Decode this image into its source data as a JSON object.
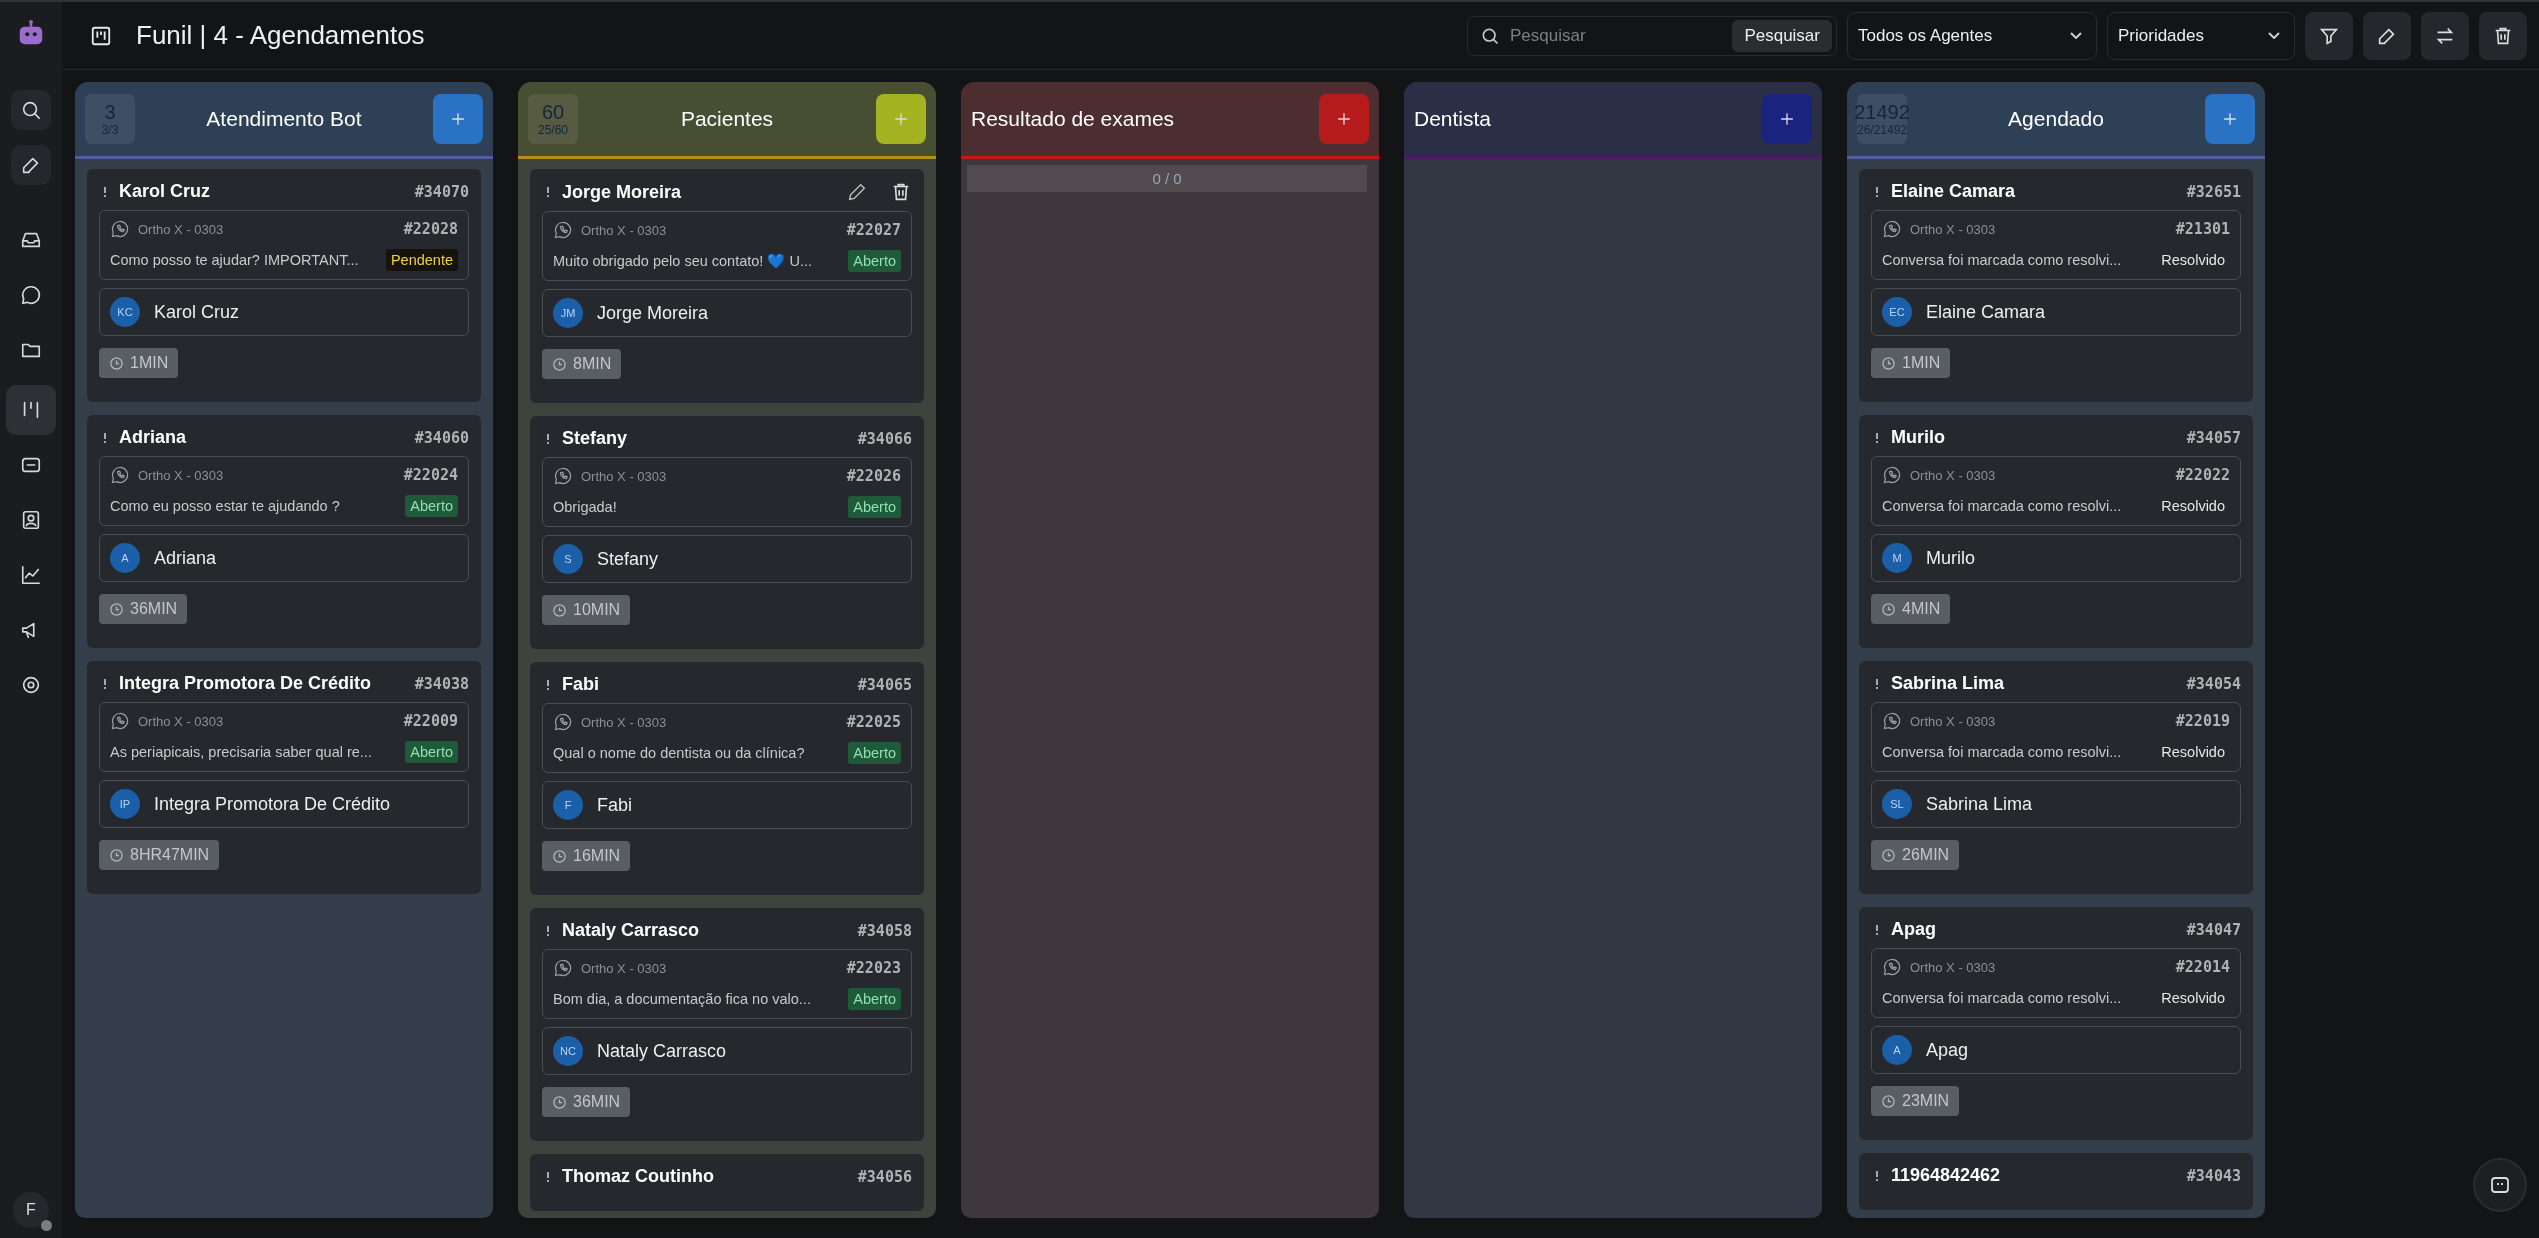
{
  "sidebar": {
    "nav": [
      {
        "selected": false
      },
      {
        "selected": false
      },
      {
        "selected": false
      },
      {
        "selected": false
      },
      {
        "selected": false
      },
      {
        "selected": true
      },
      {
        "selected": false
      },
      {
        "selected": false
      },
      {
        "selected": false
      },
      {
        "selected": false
      },
      {
        "selected": false
      }
    ],
    "user": {
      "initial": "F"
    }
  },
  "header": {
    "title": "Funil | 4 - Agendamentos",
    "search": {
      "placeholder": "Pesquisar",
      "button": "Pesquisar"
    },
    "agent_filter": "Todos os Agentes",
    "priority_filter": "Prioridades"
  },
  "columns": [
    {
      "title": "Atendimento Bot",
      "color": "#2a73c4",
      "count": "3",
      "fraction": "3/3",
      "cards": [
        {
          "name": "Karol Cruz",
          "id": "#34070",
          "show_actions": false,
          "inbox": "Ortho X - 0303",
          "conversation_id": "#22028",
          "message": "Como posso te ajudar? IMPORTANT...",
          "status": {
            "text": "Pendente",
            "kind": "pending"
          },
          "initials": "KC",
          "contact": "Karol Cruz",
          "time": "1MIN"
        },
        {
          "name": "Adriana",
          "id": "#34060",
          "show_actions": false,
          "inbox": "Ortho X - 0303",
          "conversation_id": "#22024",
          "message": "Como eu posso estar te ajudando ?",
          "status": {
            "text": "Aberto",
            "kind": "open"
          },
          "initials": "A",
          "contact": "Adriana",
          "time": "36MIN"
        },
        {
          "name": "Integra Promotora De Crédito",
          "id": "#34038",
          "show_actions": false,
          "inbox": "Ortho X - 0303",
          "conversation_id": "#22009",
          "message": "As periapicais, precisaria saber qual re...",
          "status": {
            "text": "Aberto",
            "kind": "open"
          },
          "initials": "IP",
          "contact": "Integra Promotora De Crédito",
          "time": "8HR47MIN"
        }
      ]
    },
    {
      "title": "Pacientes",
      "color": "#a4b321",
      "count": "60",
      "fraction": "25/60",
      "cards": [
        {
          "name": "Jorge Moreira",
          "show_actions": true,
          "inbox": "Ortho X - 0303",
          "conversation_id": "#22027",
          "message": "Muito obrigado pelo seu contato! 💙 U...",
          "status": {
            "text": "Aberto",
            "kind": "open"
          },
          "initials": "JM",
          "contact": "Jorge Moreira",
          "time": "8MIN"
        },
        {
          "name": "Stefany",
          "id": "#34066",
          "show_actions": false,
          "inbox": "Ortho X - 0303",
          "conversation_id": "#22026",
          "message": "Obrigada!",
          "status": {
            "text": "Aberto",
            "kind": "open"
          },
          "initials": "S",
          "contact": "Stefany",
          "time": "10MIN"
        },
        {
          "name": "Fabi",
          "id": "#34065",
          "show_actions": false,
          "inbox": "Ortho X - 0303",
          "conversation_id": "#22025",
          "message": "Qual o nome do dentista ou da clínica?",
          "status": {
            "text": "Aberto",
            "kind": "open"
          },
          "initials": "F",
          "contact": "Fabi",
          "time": "16MIN"
        },
        {
          "name": "Nataly Carrasco",
          "id": "#34058",
          "show_actions": false,
          "inbox": "Ortho X - 0303",
          "conversation_id": "#22023",
          "message": "Bom dia, a documentação fica no valo...",
          "status": {
            "text": "Aberto",
            "kind": "open"
          },
          "initials": "NC",
          "contact": "Nataly Carrasco",
          "time": "36MIN"
        },
        {
          "name": "Thomaz Coutinho",
          "id": "#34056",
          "show_actions": false
        }
      ]
    },
    {
      "title": "Resultado de exames",
      "color": "#b71c1c",
      "empty_label": "0 / 0"
    },
    {
      "title": "Dentista",
      "color": "#1a237e"
    },
    {
      "title": "Agendado",
      "color": "#2a73c4",
      "count": "21492",
      "fraction": "26/21492",
      "cards": [
        {
          "name": "Elaine Camara",
          "id": "#32651",
          "show_actions": false,
          "inbox": "Ortho X - 0303",
          "conversation_id": "#21301",
          "message": "Conversa foi marcada como resolvi...",
          "status": {
            "text": "Resolvido",
            "kind": "resolved"
          },
          "initials": "EC",
          "contact": "Elaine Camara",
          "time": "1MIN"
        },
        {
          "name": "Murilo",
          "id": "#34057",
          "show_actions": false,
          "inbox": "Ortho X - 0303",
          "conversation_id": "#22022",
          "message": "Conversa foi marcada como resolvi...",
          "status": {
            "text": "Resolvido",
            "kind": "resolved"
          },
          "initials": "M",
          "contact": "Murilo",
          "time": "4MIN"
        },
        {
          "name": "Sabrina Lima",
          "id": "#34054",
          "show_actions": false,
          "inbox": "Ortho X - 0303",
          "conversation_id": "#22019",
          "message": "Conversa foi marcada como resolvi...",
          "status": {
            "text": "Resolvido",
            "kind": "resolved"
          },
          "initials": "SL",
          "contact": "Sabrina Lima",
          "time": "26MIN"
        },
        {
          "name": "Apag",
          "id": "#34047",
          "show_actions": false,
          "inbox": "Ortho X - 0303",
          "conversation_id": "#22014",
          "message": "Conversa foi marcada como resolvi...",
          "status": {
            "text": "Resolvido",
            "kind": "resolved"
          },
          "initials": "A",
          "contact": "Apag",
          "time": "23MIN"
        },
        {
          "name": "11964842462",
          "id": "#34043",
          "show_actions": false
        }
      ]
    }
  ]
}
